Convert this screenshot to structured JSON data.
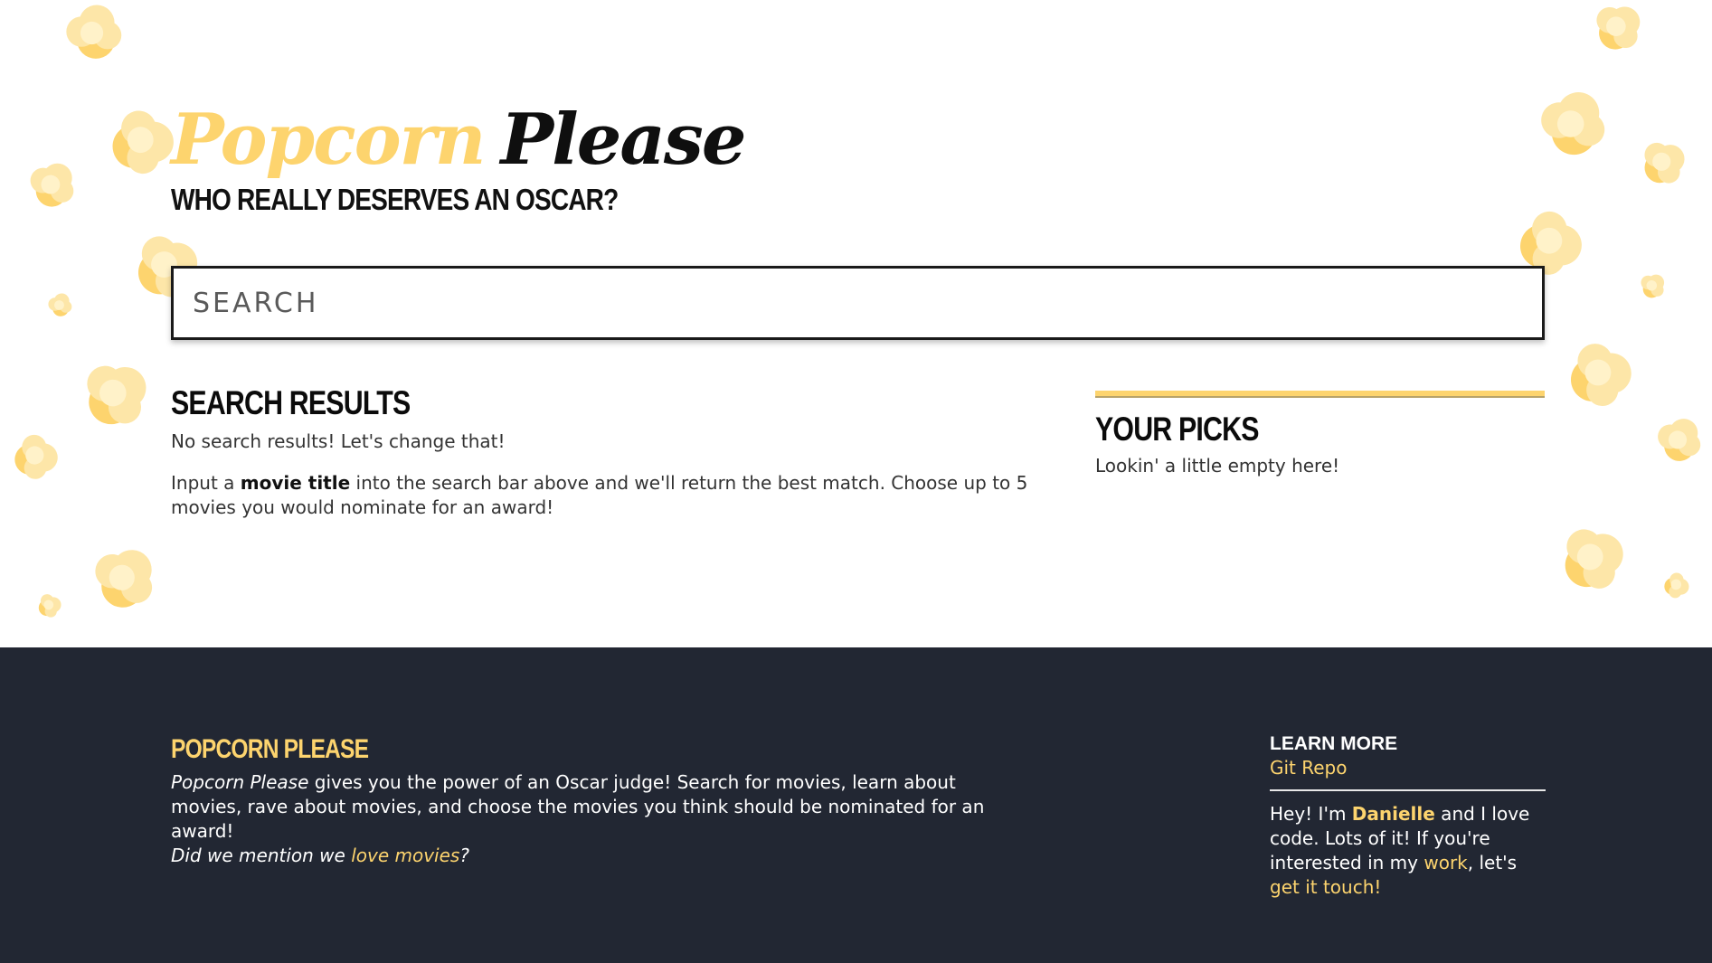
{
  "brand": {
    "word1": "Popcorn",
    "word2": "Please",
    "tagline": "WHO REALLY DESERVES AN OSCAR?"
  },
  "search": {
    "placeholder": "SEARCH",
    "value": ""
  },
  "results": {
    "heading": "SEARCH RESULTS",
    "empty_message": "No search results! Let's change that!",
    "instructions_pre": "Input a ",
    "instructions_bold": "movie title",
    "instructions_post": " into the search bar above and we'll return the best match. Choose up to 5 movies you would nominate for an award!"
  },
  "picks": {
    "heading": "YOUR PICKS",
    "empty_message": "Lookin' a little empty here!"
  },
  "footer": {
    "title": "POPCORN PLEASE",
    "about_italic": "Popcorn Please",
    "about_rest": " gives you the power of an Oscar judge! Search for movies, learn about movies, rave about movies, and choose the movies you think should be nominated for an award!",
    "mention_pre": "Did we mention we ",
    "mention_link": "love movies",
    "mention_post": "?",
    "learn_more": "LEARN MORE",
    "git_link": "Git Repo",
    "bio_pre": "Hey! I'm ",
    "bio_name": "Danielle",
    "bio_mid": " and I love code. Lots of it! If you're interested in my ",
    "bio_work": "work",
    "bio_mid2": ", let's ",
    "bio_touch": "get it touch!"
  },
  "colors": {
    "accent": "#fdd46e",
    "footer_bg": "#222733",
    "text": "#333333",
    "popcorn_light": "#fde6a8",
    "popcorn_mid": "#fdd46e"
  },
  "decor": {
    "icon": "popcorn-kernel-icon"
  }
}
